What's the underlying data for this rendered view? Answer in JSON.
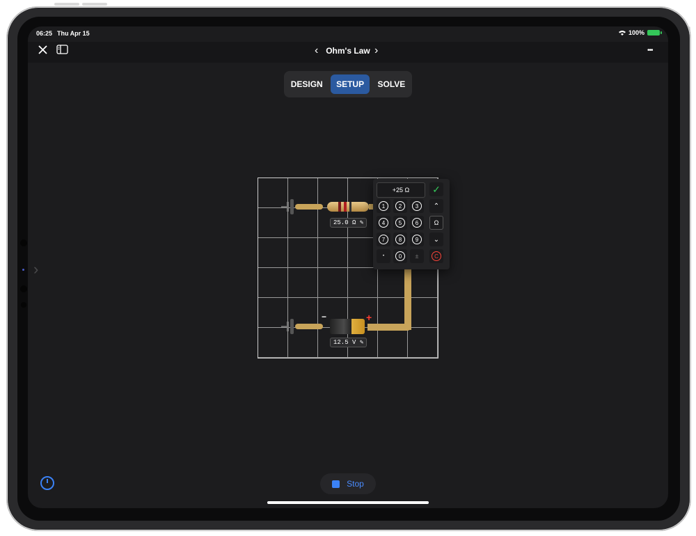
{
  "status": {
    "time": "06:25",
    "date": "Thu Apr 15",
    "battery": "100%"
  },
  "nav": {
    "title": "Ohm's Law",
    "prev": "‹",
    "next": "›",
    "more": "•••"
  },
  "tabs": [
    {
      "label": "DESIGN",
      "active": false
    },
    {
      "label": "SETUP",
      "active": true
    },
    {
      "label": "SOLVE",
      "active": false
    }
  ],
  "circuit": {
    "resistor_label": "25.0 Ω",
    "battery_label": "12.5 V",
    "battery_minus": "−",
    "battery_plus": "+"
  },
  "keypad": {
    "display": "+25 Ω",
    "keys": [
      "1",
      "2",
      "3",
      "4",
      "5",
      "6",
      "7",
      "8",
      "9",
      "•",
      "0",
      "±"
    ],
    "side": {
      "confirm": "✓",
      "up": "⌃",
      "unit": "Ω",
      "down": "⌄",
      "clear": "C"
    }
  },
  "stop": {
    "label": "Stop"
  },
  "colors": {
    "accent": "#2b5aa0",
    "wire": "#c8a45a",
    "confirm": "#34c759",
    "clear": "#ff453a",
    "stop": "#3b82f6"
  },
  "icons": {
    "close": "close-icon",
    "sidebar": "sidebar-icon",
    "gauge": "gauge-icon"
  }
}
